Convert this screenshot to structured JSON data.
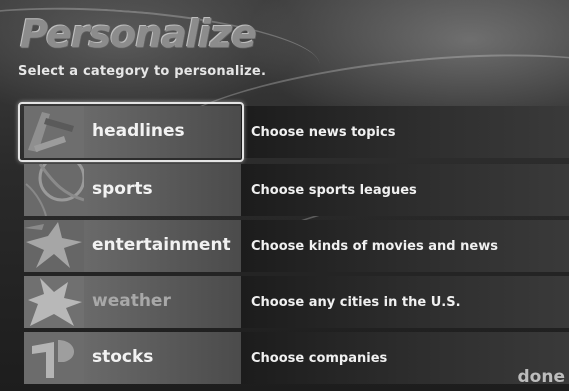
{
  "screen": {
    "title": "Personalize",
    "subtitle": "Select a category to personalize.",
    "done_label": "done"
  },
  "categories": [
    {
      "label": "headlines",
      "description": "Choose news topics",
      "icon": "headlines-icon",
      "selected": true
    },
    {
      "label": "sports",
      "description": "Choose sports leagues",
      "icon": "sports-icon",
      "selected": false
    },
    {
      "label": "entertainment",
      "description": "Choose kinds of movies and news",
      "icon": "entertainment-icon",
      "selected": false
    },
    {
      "label": "weather",
      "description": "Choose any cities in the U.S.",
      "icon": "weather-icon",
      "selected": false
    },
    {
      "label": "stocks",
      "description": "Choose companies",
      "icon": "stocks-icon",
      "selected": false
    }
  ],
  "colors": {
    "selection_border": "#e4e4e4",
    "label_text": "#f2f2f2",
    "dim_label_text": "#a8a8a8"
  }
}
